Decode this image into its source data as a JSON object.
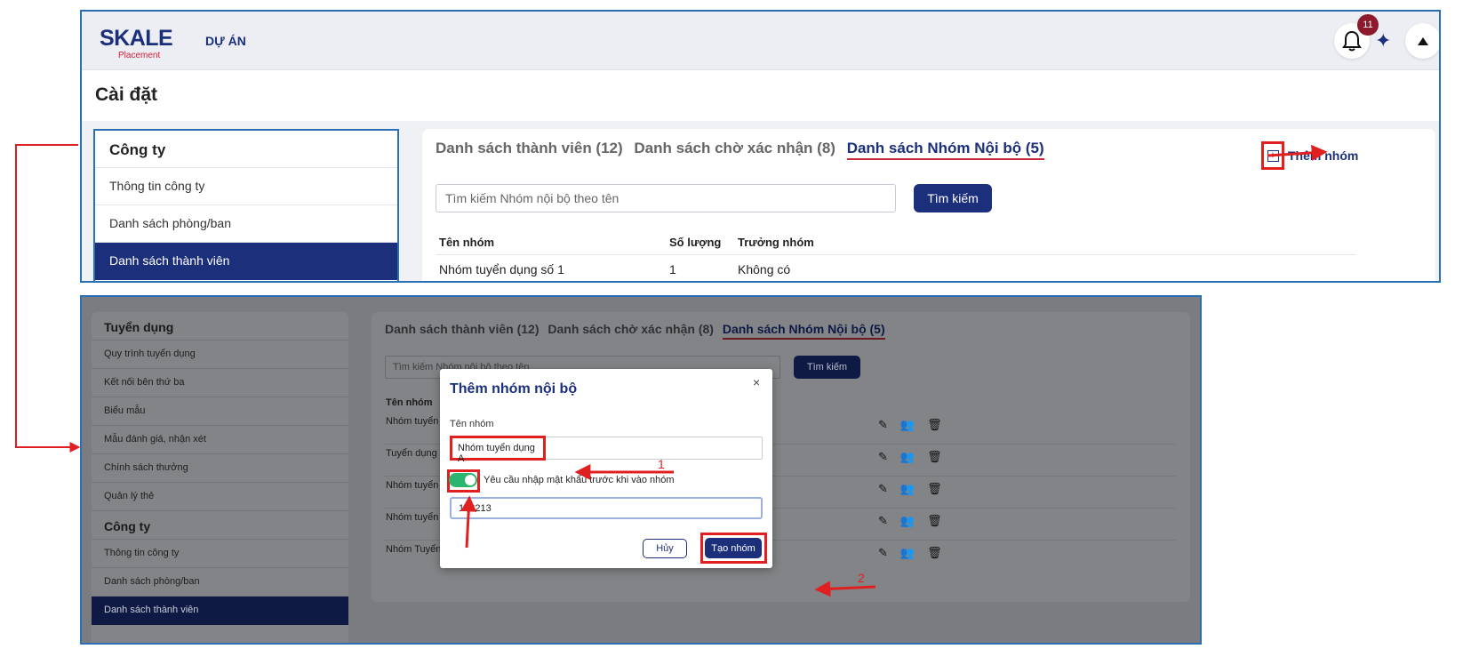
{
  "top": {
    "logo_text": "SKALE",
    "logo_sub": "Placement",
    "nav_project": "DỰ ÁN",
    "notification_count": "11",
    "page_title": "Cài đặt",
    "sidebar": {
      "header": "Công ty",
      "items": [
        "Thông tin công ty",
        "Danh sách phòng/ban",
        "Danh sách thành viên"
      ]
    },
    "tabs": [
      "Danh sách thành viên (12)",
      "Danh sách chờ xác nhận (8)",
      "Danh sách Nhóm Nội bộ (5)"
    ],
    "add_group_label": "Thêm nhóm",
    "search_placeholder": "Tìm kiếm Nhóm nội bộ theo tên",
    "search_button": "Tìm kiếm",
    "table": {
      "columns": [
        "Tên nhóm",
        "Số lượng",
        "Trưởng nhóm"
      ],
      "first_row": [
        "Nhóm tuyển dụng số 1",
        "1",
        "Không có"
      ]
    }
  },
  "bottom": {
    "sidebar": {
      "sections": [
        {
          "header": "Tuyển dụng",
          "items": [
            "Quy trình tuyển dụng",
            "Kết nối bên thứ ba",
            "Biểu mẫu",
            "Mẫu đánh giá, nhận xét",
            "Chính sách thưởng",
            "Quản lý thẻ"
          ]
        },
        {
          "header": "Công ty",
          "items": [
            "Thông tin công ty",
            "Danh sách phòng/ban",
            "Danh sách thành viên"
          ]
        }
      ]
    },
    "tabs": [
      "Danh sách thành viên (12)",
      "Danh sách chờ xác nhận (8)",
      "Danh sách Nhóm Nội bộ (5)"
    ],
    "search_placeholder": "Tìm kiếm Nhóm nội bộ theo tên",
    "search_button": "Tìm kiếm",
    "table_header": "Tên nhóm",
    "rows": [
      "Nhóm tuyển dụng",
      "Tuyển dụng khối v",
      "Nhóm tuyển dụng",
      "Nhóm tuyển dụng",
      "Nhóm Tuyển công"
    ],
    "modal": {
      "title": "Thêm nhóm nội bộ",
      "close": "×",
      "name_label": "Tên nhóm",
      "name_value": "Nhóm tuyển dụng A",
      "password_toggle_label": "Yêu cầu nhập mật khẩu trước khi vào nhóm",
      "password_value": "123213",
      "cancel_button": "Hủy",
      "create_button": "Tạo nhóm"
    },
    "step_labels": [
      "1",
      "2"
    ]
  },
  "colors": {
    "brand_navy": "#1b2f7a",
    "annotation_red": "#e02020",
    "toggle_on": "#2bb56d",
    "panel_border": "#2a6fb3"
  }
}
